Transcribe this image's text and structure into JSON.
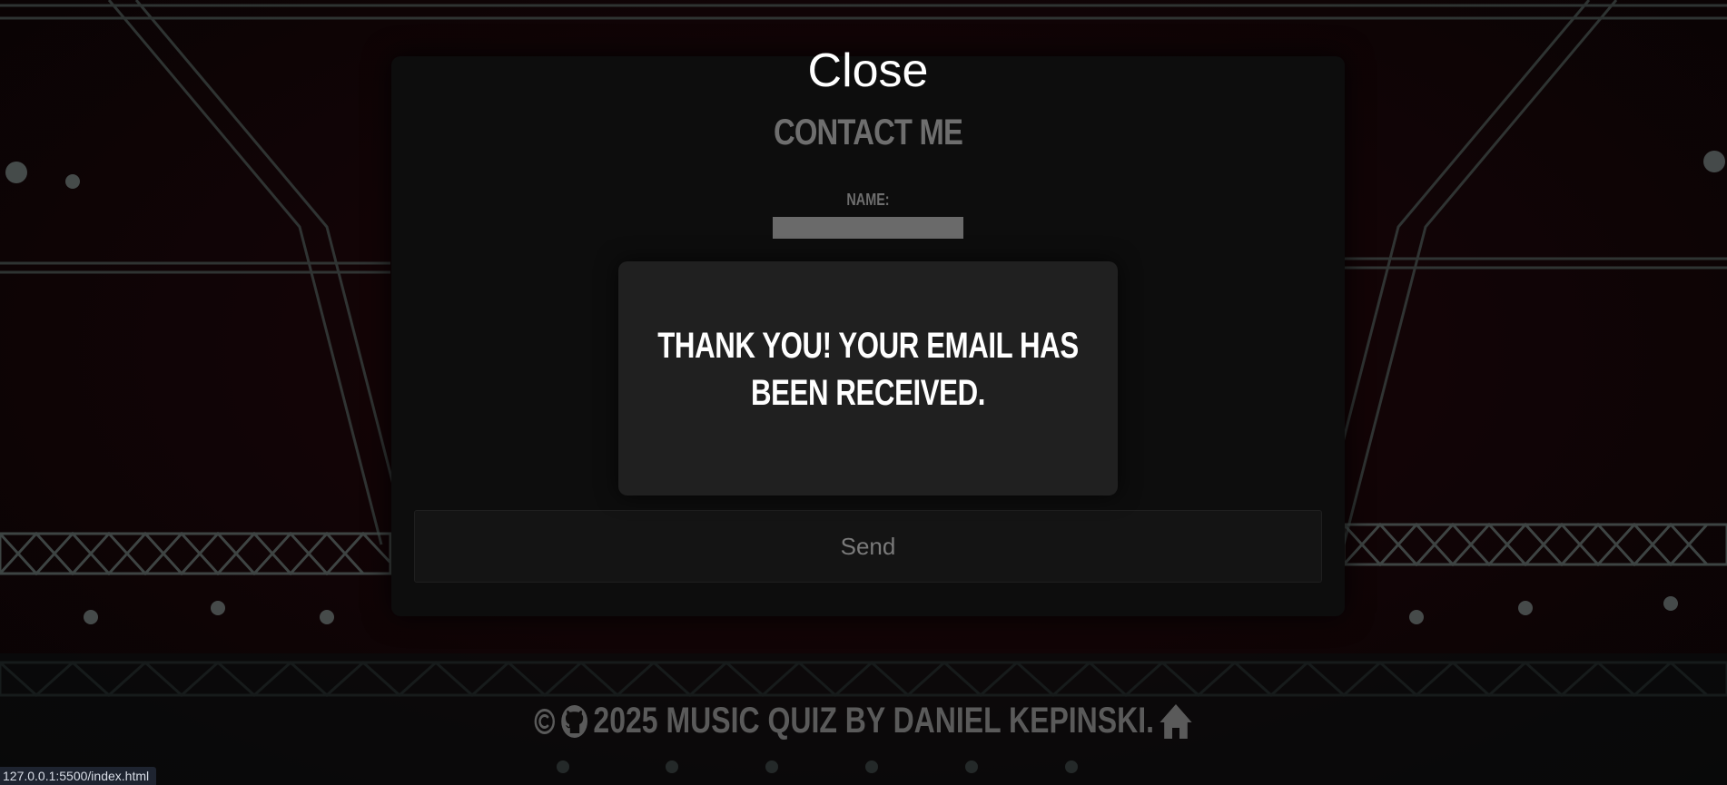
{
  "modal": {
    "close_label": "Close",
    "title": "Contact me",
    "name_label": "Name:",
    "name_value": "",
    "send_label": "Send"
  },
  "popup": {
    "message": "Thank you! Your email has been received."
  },
  "footer": {
    "copyright_icon": "copyright-icon",
    "github_icon": "github-icon",
    "text": "2025 Music Quiz by Daniel Kepinski.",
    "home_icon": "home-icon"
  },
  "status_bar": {
    "url": "127.0.0.1:5500/index.html"
  },
  "colors": {
    "modal_bg": "#0d0d0d",
    "popup_bg": "#202020",
    "muted_text": "#6e6e6e",
    "footer_text": "#5a5a5a"
  }
}
